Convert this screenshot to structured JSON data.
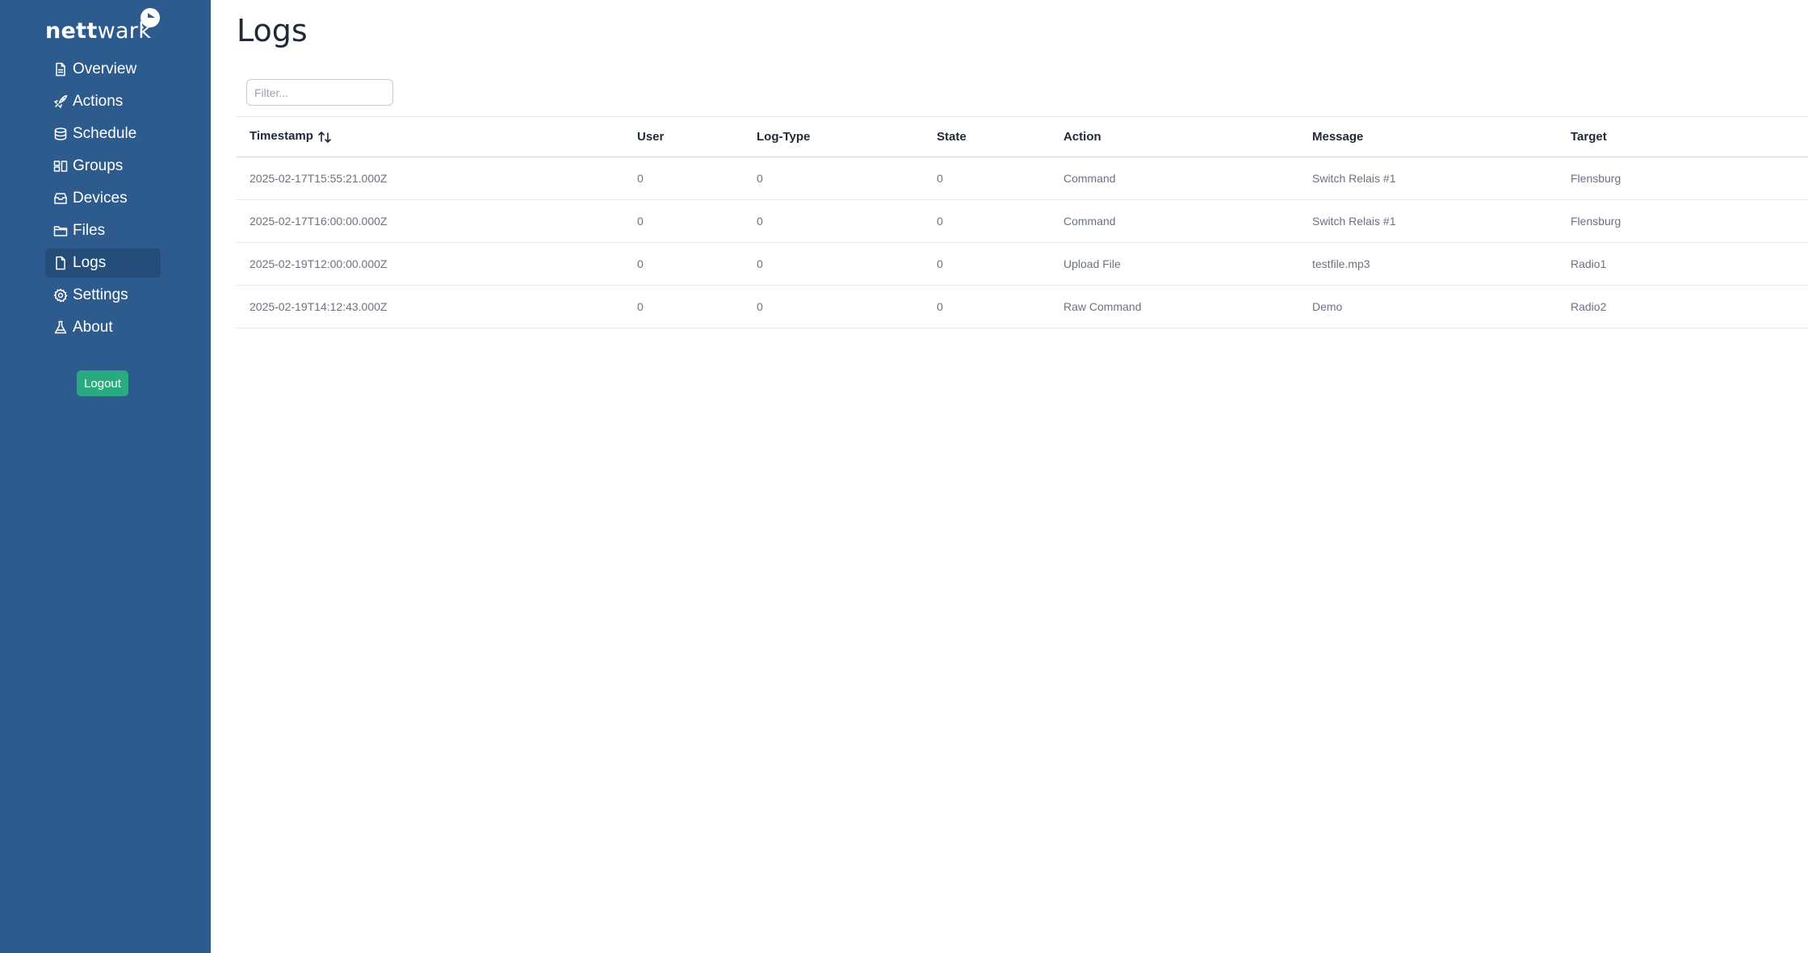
{
  "brand": {
    "name_bold": "nett",
    "name_light": "wark",
    "accent": "#2d5b8d"
  },
  "sidebar": {
    "items": [
      {
        "label": "Overview",
        "icon": "file-icon"
      },
      {
        "label": "Actions",
        "icon": "rocket-icon"
      },
      {
        "label": "Schedule",
        "icon": "database-icon"
      },
      {
        "label": "Groups",
        "icon": "groups-icon"
      },
      {
        "label": "Devices",
        "icon": "inbox-icon"
      },
      {
        "label": "Files",
        "icon": "folder-icon"
      },
      {
        "label": "Logs",
        "icon": "document-icon",
        "active": true
      },
      {
        "label": "Settings",
        "icon": "gear-icon"
      },
      {
        "label": "About",
        "icon": "flask-icon"
      }
    ],
    "logout_label": "Logout",
    "logout_color": "#2aaa80"
  },
  "main": {
    "title": "Logs",
    "filter_placeholder": "Filter...",
    "filter_value": ""
  },
  "table": {
    "columns": [
      "Timestamp",
      "User",
      "Log-Type",
      "State",
      "Action",
      "Message",
      "Target"
    ],
    "rows": [
      [
        "2025-02-17T15:55:21.000Z",
        "0",
        "0",
        "0",
        "Command",
        "Switch Relais #1",
        "Flensburg"
      ],
      [
        "2025-02-17T16:00:00.000Z",
        "0",
        "0",
        "0",
        "Command",
        "Switch Relais #1",
        "Flensburg"
      ],
      [
        "2025-02-19T12:00:00.000Z",
        "0",
        "0",
        "0",
        "Upload File",
        "testfile.mp3",
        "Radio1"
      ],
      [
        "2025-02-19T14:12:43.000Z",
        "0",
        "0",
        "0",
        "Raw Command",
        "Demo",
        "Radio2"
      ]
    ]
  }
}
